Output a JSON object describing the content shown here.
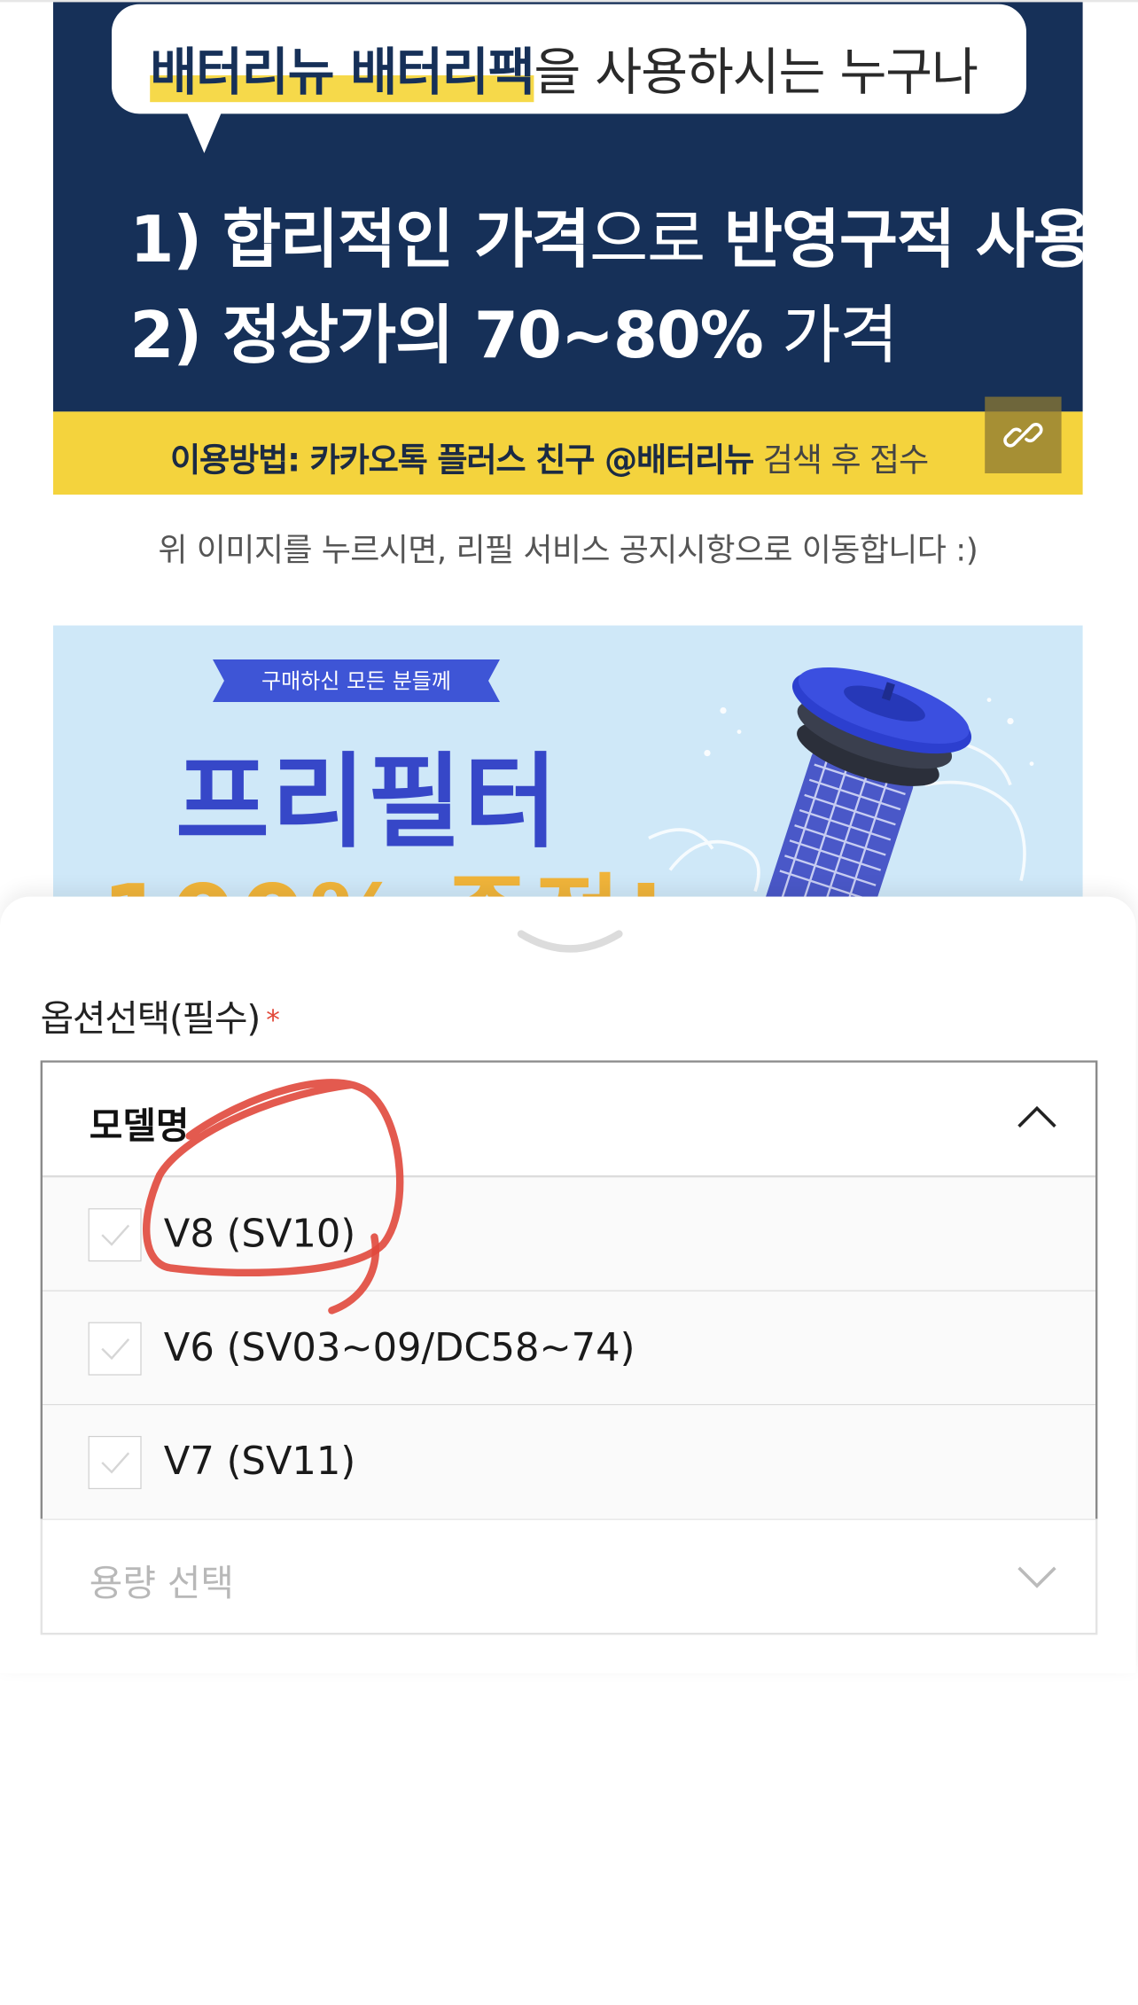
{
  "banner_top": {
    "bubble": {
      "highlight": "배터리뉴 배터리팩",
      "rest": "을 사용하시는 누구나"
    },
    "line1": {
      "bold_a": "1) 합리적인 가격",
      "light": "으로 ",
      "bold_b": "반영구적 사용"
    },
    "line2": {
      "bold": "2) 정상가의 70~80%",
      "light": " 가격"
    },
    "usage": {
      "bold": "이용방법: 카카오톡 플러스 친구 @배터리뉴",
      "light": " 검색 후 접수"
    },
    "link_icon": "link-icon"
  },
  "notice": "위 이미지를 누르시면, 리필 서비스 공지시항으로 이동합니다 :)",
  "banner_filter": {
    "ribbon": "구매하신 모든 분들께",
    "title": "프리필터",
    "subtitle": "100% 증정!"
  },
  "sheet": {
    "option_title": "옵션선택(필수)",
    "required_mark": "*",
    "model_dropdown": {
      "label": "모델명",
      "expanded": true,
      "options": [
        {
          "label": "V8 (SV10)"
        },
        {
          "label": "V6 (SV03~09/DC58~74)"
        },
        {
          "label": "V7 (SV11)"
        }
      ]
    },
    "capacity_dropdown": {
      "placeholder": "용량 선택"
    }
  },
  "colors": {
    "navy": "#163058",
    "yellow": "#f4d33d",
    "filter_blue": "#3647c8",
    "annotation_red": "#e0483c"
  }
}
